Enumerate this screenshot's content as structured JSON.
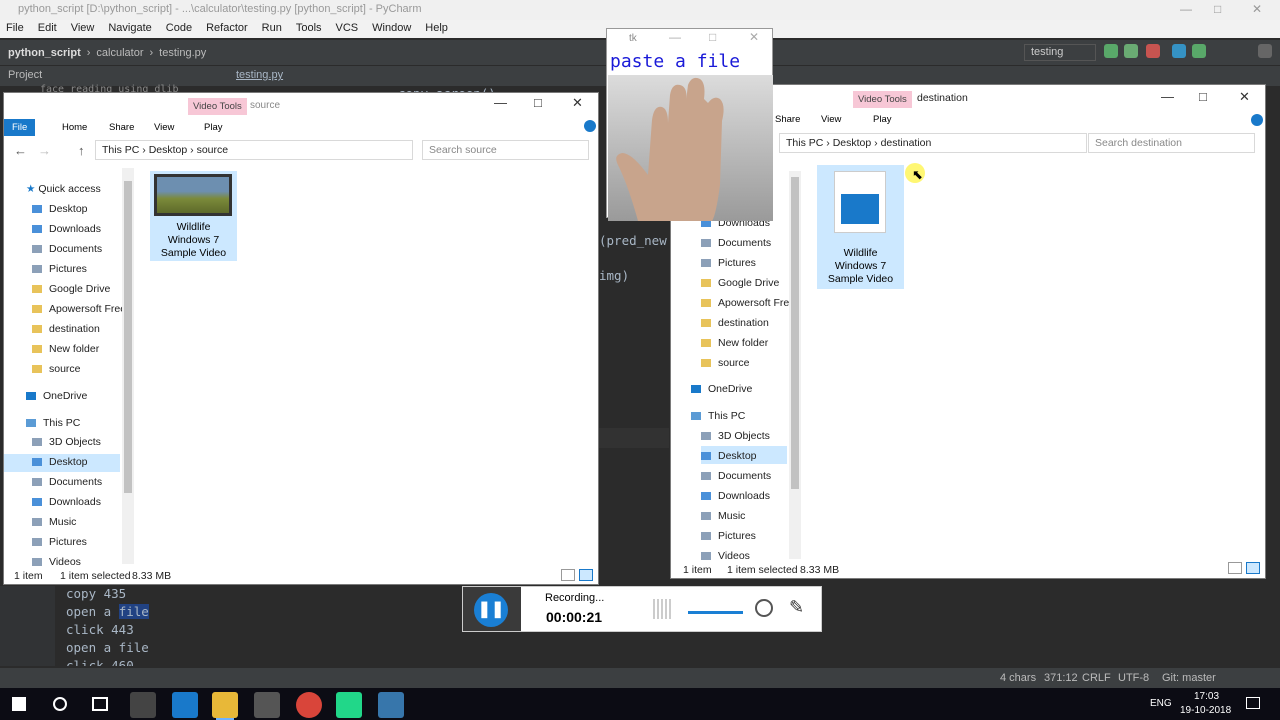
{
  "pycharm": {
    "title": "python_script [D:\\python_script] - ...\\calculator\\testing.py [python_script] - PyCharm",
    "menu": [
      "File",
      "Edit",
      "View",
      "Navigate",
      "Code",
      "Refactor",
      "Run",
      "Tools",
      "VCS",
      "Window",
      "Help"
    ],
    "breadcrumb": [
      "python_script",
      "calculator",
      "testing.py"
    ],
    "run_config": "testing",
    "project_label": "Project",
    "tab": "testing.py",
    "code_top": [
      "face_reading_using_dlib",
      "copy_screen()"
    ],
    "code_right": [
      "(pred_new",
      "img)"
    ],
    "console": [
      "copy 435",
      "open a file",
      "click 443",
      "open a file",
      "click 460"
    ],
    "status": {
      "chars": "4 chars",
      "pos": "371:12",
      "crlf": "CRLF",
      "enc": "UTF-8",
      "git": "Git: master"
    }
  },
  "tk": {
    "title": "tk",
    "overlay_text": "paste a file"
  },
  "source_win": {
    "video_tools": "Video Tools",
    "name": "source",
    "tabs": [
      "File",
      "Home",
      "Share",
      "View",
      "Play"
    ],
    "path": [
      "This PC",
      "Desktop",
      "source"
    ],
    "search": "Search source",
    "nav": [
      "Quick access",
      "Desktop",
      "Downloads",
      "Documents",
      "Pictures",
      "Google Drive",
      "Apowersoft Free",
      "destination",
      "New folder",
      "source",
      "OneDrive",
      "This PC",
      "3D Objects",
      "Desktop",
      "Documents",
      "Downloads",
      "Music",
      "Pictures",
      "Videos"
    ],
    "file": "Wildlife Windows 7 Sample Video",
    "file_lines": [
      "Wildlife",
      "Windows 7",
      "Sample Video"
    ],
    "status": [
      "1 item",
      "1 item selected",
      "8.33 MB"
    ]
  },
  "dest_win": {
    "video_tools": "Video Tools",
    "name": "destination",
    "tabs": [
      "Share",
      "View",
      "Play"
    ],
    "path": [
      "This PC",
      "Desktop",
      "destination"
    ],
    "search": "Search destination",
    "nav": [
      "Downloads",
      "Documents",
      "Pictures",
      "Google Drive",
      "Apowersoft Free",
      "destination",
      "New folder",
      "source",
      "OneDrive",
      "This PC",
      "3D Objects",
      "Desktop",
      "Documents",
      "Downloads",
      "Music",
      "Pictures",
      "Videos"
    ],
    "file_lines": [
      "Wildlife",
      "Windows 7",
      "Sample Video"
    ],
    "status": [
      "1 item",
      "1 item selected",
      "8.33 MB"
    ]
  },
  "recorder": {
    "label": "Recording...",
    "time": "00:00:21"
  },
  "taskbar": {
    "lang": "ENG",
    "time": "17:03",
    "date": "19-10-2018"
  },
  "colors": {
    "accent": "#1979ca",
    "video_tools": "#f7c7d6",
    "selection": "#cce8ff"
  }
}
